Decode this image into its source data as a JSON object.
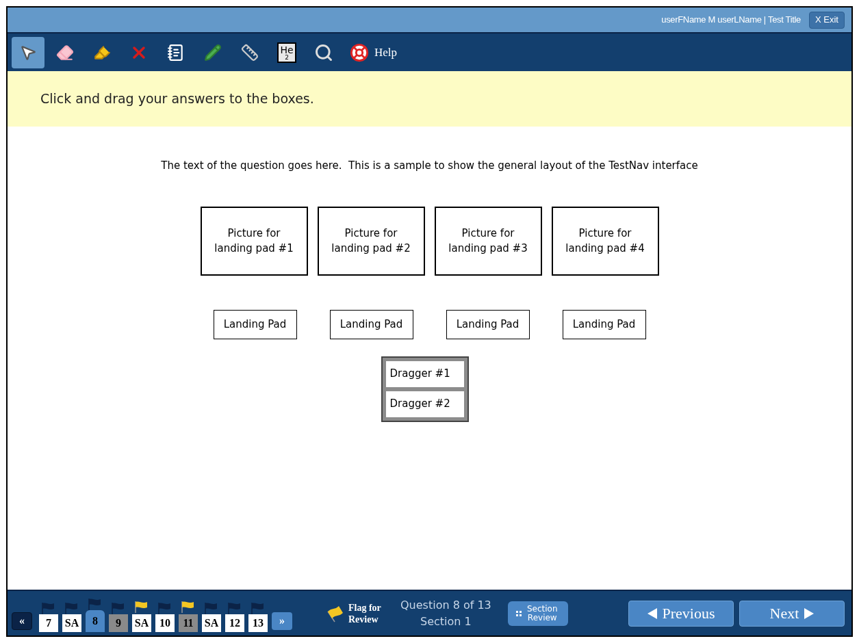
{
  "header": {
    "user": "userFName M userLName | Test Title",
    "exit": "X Exit"
  },
  "toolbar": {
    "tools": [
      {
        "kind": "pointer",
        "selected": true
      },
      {
        "kind": "eraser",
        "selected": false
      },
      {
        "kind": "highlighter",
        "selected": false
      },
      {
        "kind": "cross",
        "selected": false
      },
      {
        "kind": "notepad",
        "selected": false
      },
      {
        "kind": "pencil",
        "selected": false
      },
      {
        "kind": "ruler",
        "selected": false
      },
      {
        "kind": "element",
        "selected": false,
        "symbol": "He",
        "number": "2"
      },
      {
        "kind": "magnifier",
        "selected": false
      }
    ],
    "help": "Help"
  },
  "instruction": "Click and drag your answers to the boxes.",
  "question": "The text of the question goes here.  This is a sample to show the general layout of the TestNav interface",
  "pictures": [
    "Picture for landing pad #1",
    "Picture for landing pad #2",
    "Picture for landing pad #3",
    "Picture for landing pad #4"
  ],
  "landing_pads": [
    "Landing Pad",
    "Landing Pad",
    "Landing Pad",
    "Landing Pad"
  ],
  "draggers": [
    "Dragger #1",
    "Dragger #2"
  ],
  "footer": {
    "prev_arrow": "«",
    "next_arrow": "»",
    "questions": [
      {
        "label": "7",
        "selected": false,
        "answered": false,
        "flagged": false
      },
      {
        "label": "SA",
        "selected": false,
        "answered": false,
        "flagged": false
      },
      {
        "label": "8",
        "selected": true,
        "answered": false,
        "flagged": false
      },
      {
        "label": "9",
        "selected": false,
        "answered": true,
        "flagged": false
      },
      {
        "label": "SA",
        "selected": false,
        "answered": false,
        "flagged": true
      },
      {
        "label": "10",
        "selected": false,
        "answered": false,
        "flagged": false
      },
      {
        "label": "11",
        "selected": false,
        "answered": true,
        "flagged": true
      },
      {
        "label": "SA",
        "selected": false,
        "answered": false,
        "flagged": false
      },
      {
        "label": "12",
        "selected": false,
        "answered": false,
        "flagged": false
      },
      {
        "label": "13",
        "selected": false,
        "answered": false,
        "flagged": false
      }
    ],
    "flag_for_review": "Flag for Review",
    "position": "Question 8 of 13",
    "section": "Section 1",
    "section_review": "Section Review",
    "previous": "Previous",
    "next": "Next"
  }
}
